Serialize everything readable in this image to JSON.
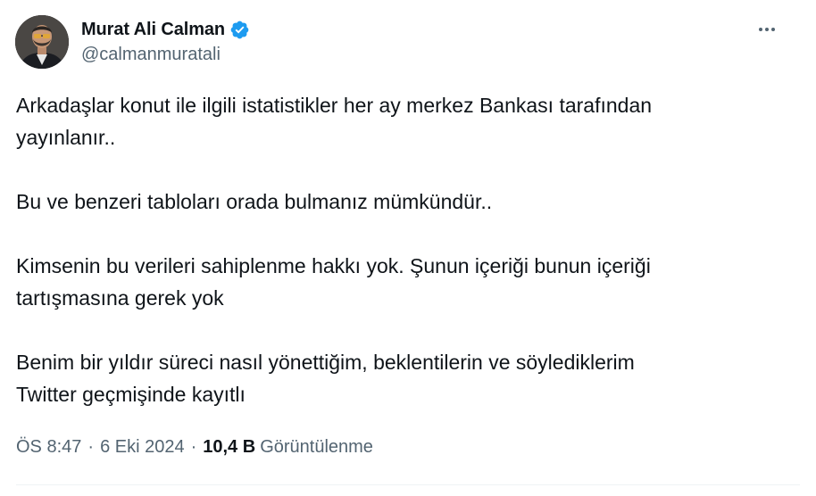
{
  "author": {
    "display_name": "Murat Ali Calman",
    "handle": "@calmanmuratali",
    "verified": true,
    "verified_color": "#1d9bf0"
  },
  "tweet": {
    "paragraphs": [
      "Arkadaşlar konut ile ilgili istatistikler her ay merkez Bankası tarafından\nyayınlanır..",
      "Bu ve benzeri tabloları orada bulmanız mümkündür..",
      "Kimsenin bu verileri sahiplenme hakkı yok. Şunun içeriği bunun içeriği\ntartışmasına gerek yok",
      "Benim bir yıldır süreci nasıl yönettiğim, beklentilerin ve söylediklerim\nTwitter geçmişinde kayıtlı"
    ]
  },
  "meta": {
    "time": "ÖS 8:47",
    "separator": "·",
    "date": "6 Eki 2024",
    "views_count": "10,4 B",
    "views_label": "Görüntülenme"
  },
  "icons": {
    "more": "more-horizontal-icon",
    "verified": "verified-badge-icon"
  },
  "colors": {
    "text_primary": "#0f1419",
    "text_secondary": "#536471",
    "divider": "#eff3f4"
  }
}
